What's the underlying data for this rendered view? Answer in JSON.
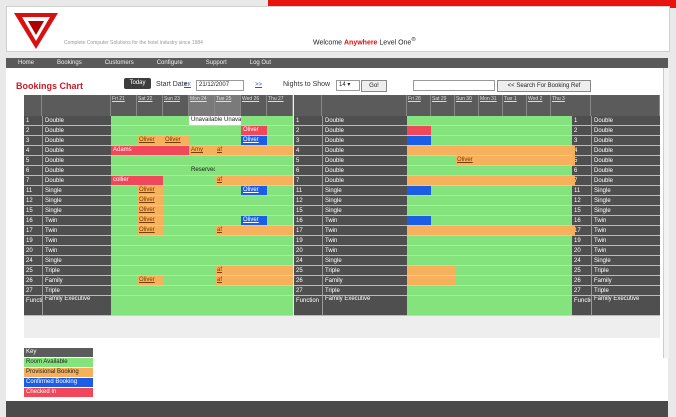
{
  "header": {
    "tagline": "Complete Computer Solutions for the hotel industry since 1984",
    "welcome_prefix": "Welcome ",
    "welcome_accent": "Anywhere",
    "welcome_suffix": " Level One"
  },
  "nav": [
    "Home",
    "Bookings",
    "Customers",
    "Configure",
    "Support",
    "Log Out"
  ],
  "toolbar": {
    "title": "Bookings Chart",
    "today": "Today",
    "start_date_label": "Start Date:",
    "prev": "<<",
    "date": "21/12/2007",
    "next": ">>",
    "nights_label": "Nights to Show",
    "nights": "14 ▾",
    "go": "Go!",
    "search_button": "<< Search For Booking Ref"
  },
  "days_block1": [
    "Fri 21",
    "Sat 22",
    "Sun 23",
    "Mon 24",
    "Tue 25",
    "Wed 26",
    "Thu 27"
  ],
  "days_block2": [
    "Fri 28",
    "Sat 29",
    "Sun 30",
    "Mon 31",
    "Tue 1",
    "Wed 2",
    "Thu 3"
  ],
  "rooms": [
    {
      "num": "1",
      "type": "Double"
    },
    {
      "num": "2",
      "type": "Double"
    },
    {
      "num": "3",
      "type": "Double"
    },
    {
      "num": "4",
      "type": "Double"
    },
    {
      "num": "5",
      "type": "Double"
    },
    {
      "num": "6",
      "type": "Double"
    },
    {
      "num": "7",
      "type": "Double"
    },
    {
      "num": "11",
      "type": "Single"
    },
    {
      "num": "12",
      "type": "Single"
    },
    {
      "num": "15",
      "type": "Single"
    },
    {
      "num": "16",
      "type": "Twin"
    },
    {
      "num": "17",
      "type": "Twin"
    },
    {
      "num": "19",
      "type": "Twin"
    },
    {
      "num": "20",
      "type": "Twin"
    },
    {
      "num": "24",
      "type": "Single"
    },
    {
      "num": "25",
      "type": "Triple"
    },
    {
      "num": "26",
      "type": "Family"
    },
    {
      "num": "27",
      "type": "Triple"
    },
    {
      "num": "Function",
      "type": "Family Executive"
    }
  ],
  "bookings": [
    {
      "row": 0,
      "start": 3,
      "span": 2,
      "status": "unavailable",
      "label": "Unavailable  Unavailable"
    },
    {
      "row": 1,
      "start": 5,
      "span": 1,
      "status": "confirmed-red",
      "label": "Oliver"
    },
    {
      "row": 2,
      "start": 1,
      "span": 1,
      "status": "provisional",
      "label": "Oliver"
    },
    {
      "row": 2,
      "start": 2,
      "span": 1,
      "status": "provisional",
      "label": "Oliver"
    },
    {
      "row": 2,
      "start": 5,
      "span": 1,
      "status": "confirmed",
      "label": "Oliver"
    },
    {
      "row": 3,
      "start": 0,
      "span": 2,
      "status": "confirmed-red",
      "label": "Adams"
    },
    {
      "row": 3,
      "start": 2,
      "span": 1,
      "status": "confirmed-red",
      "label": ""
    },
    {
      "row": 3,
      "start": 3,
      "span": 1,
      "status": "provisional",
      "label": "Amy"
    },
    {
      "row": 3,
      "start": 4,
      "span": 3,
      "status": "provisional",
      "label": "af"
    },
    {
      "row": 5,
      "start": 3,
      "span": 1,
      "status": "reserved",
      "label": "Reserved"
    },
    {
      "row": 6,
      "start": 0,
      "span": 2,
      "status": "confirmed-red",
      "label": "collier"
    },
    {
      "row": 6,
      "start": 4,
      "span": 3,
      "status": "provisional",
      "label": "af"
    },
    {
      "row": 7,
      "start": 1,
      "span": 1,
      "status": "provisional",
      "label": "Oliver"
    },
    {
      "row": 7,
      "start": 5,
      "span": 1,
      "status": "confirmed",
      "label": "Oliver"
    },
    {
      "row": 8,
      "start": 1,
      "span": 1,
      "status": "provisional",
      "label": "Oliver"
    },
    {
      "row": 9,
      "start": 1,
      "span": 1,
      "status": "provisional",
      "label": "Oliver"
    },
    {
      "row": 10,
      "start": 1,
      "span": 1,
      "status": "provisional",
      "label": "Oliver"
    },
    {
      "row": 10,
      "start": 5,
      "span": 1,
      "status": "confirmed",
      "label": "Oliver"
    },
    {
      "row": 11,
      "start": 1,
      "span": 1,
      "status": "provisional",
      "label": "Oliver"
    },
    {
      "row": 11,
      "start": 4,
      "span": 3,
      "status": "provisional",
      "label": "af"
    },
    {
      "row": 15,
      "start": 4,
      "span": 3,
      "status": "provisional",
      "label": "af"
    },
    {
      "row": 16,
      "start": 1,
      "span": 1,
      "status": "provisional",
      "label": "Oliver"
    },
    {
      "row": 16,
      "start": 4,
      "span": 3,
      "status": "provisional",
      "label": "af"
    }
  ],
  "bookings2": [
    {
      "row": 1,
      "start": 0,
      "span": 1,
      "status": "confirmed-red",
      "label": ""
    },
    {
      "row": 2,
      "start": 0,
      "span": 1,
      "status": "confirmed",
      "label": ""
    },
    {
      "row": 3,
      "start": 0,
      "span": 7,
      "status": "provisional",
      "label": ""
    },
    {
      "row": 4,
      "start": 2,
      "span": 5,
      "status": "provisional",
      "label": "Oliver"
    },
    {
      "row": 6,
      "start": 0,
      "span": 7,
      "status": "provisional",
      "label": ""
    },
    {
      "row": 7,
      "start": 0,
      "span": 1,
      "status": "confirmed",
      "label": ""
    },
    {
      "row": 10,
      "start": 0,
      "span": 1,
      "status": "confirmed",
      "label": ""
    },
    {
      "row": 11,
      "start": 0,
      "span": 7,
      "status": "provisional",
      "label": ""
    },
    {
      "row": 15,
      "start": 0,
      "span": 2,
      "status": "provisional",
      "label": ""
    },
    {
      "row": 16,
      "start": 0,
      "span": 2,
      "status": "provisional",
      "label": ""
    }
  ],
  "key": {
    "title": "Key",
    "items": [
      {
        "label": "Room Available",
        "color": "#84e37c"
      },
      {
        "label": "Provisional Booking",
        "color": "#f7b05c"
      },
      {
        "label": "Confirmed Booking",
        "color": "#1a5ee6"
      },
      {
        "label": "Checked In",
        "color": "#f0485a"
      }
    ]
  },
  "colors": {
    "accent_red": "#e8150f",
    "available": "#84e37c",
    "provisional": "#f7b05c",
    "confirmed": "#1a5ee6",
    "checked_in": "#f0485a"
  }
}
